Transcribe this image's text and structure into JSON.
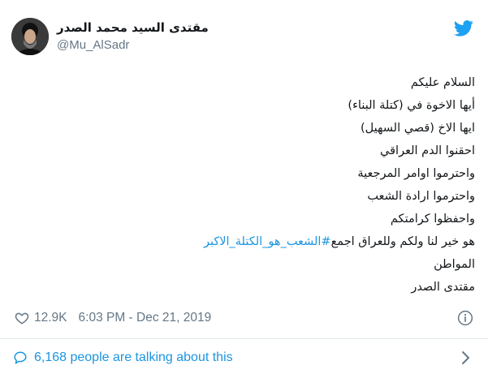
{
  "tweet": {
    "author": {
      "display_name": "مقتدى السيد محمد الصدر",
      "handle": "@Mu_AlSadr"
    },
    "lines": [
      "السلام عليكم",
      "أيها الاخوة في (كتلة البناء)",
      "ايها الاخ (قصي السهيل)",
      "احقنوا الدم العراقي",
      "واحترموا اوامر المرجعية",
      "واحترموا ارادة الشعب",
      "واحفظوا كرامتكم",
      "",
      "المواطن",
      "مقتدى الصدر"
    ],
    "hashtag_line": {
      "text": "هو خير لنا ولكم وللعراق اجمع",
      "hashtag": "#الشعب_هو_الكتلة_الاكبر"
    },
    "likes": "12.9K",
    "timestamp": "6:03 PM - Dec 21, 2019",
    "talking": "6,168 people are talking about this"
  },
  "icons": {
    "brand": "twitter-bird-icon",
    "like": "heart-icon",
    "info": "info-icon",
    "reply": "speech-bubble-icon",
    "more": "chevron-right-icon"
  },
  "colors": {
    "accent": "#1b95e0",
    "muted": "#657786",
    "text": "#14171a",
    "divider": "#e1e8ed",
    "twitter_blue": "#1da1f2"
  }
}
